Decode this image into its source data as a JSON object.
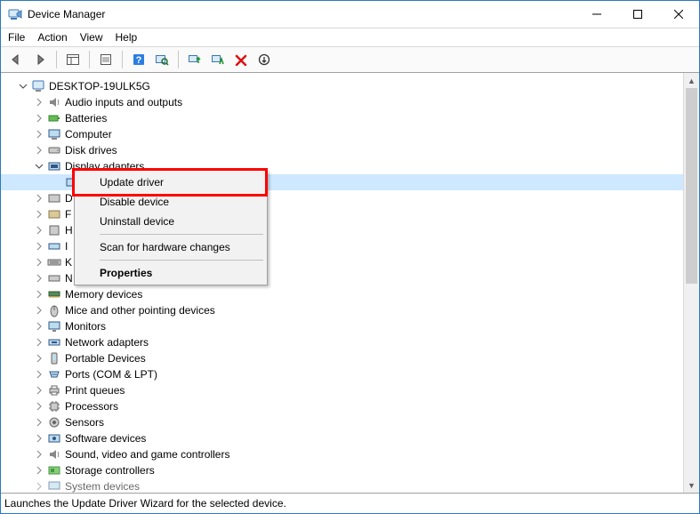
{
  "window": {
    "title": "Device Manager"
  },
  "menu": {
    "file": "File",
    "action": "Action",
    "view": "View",
    "help": "Help"
  },
  "tree": {
    "root": "DESKTOP-19ULK5G",
    "nodes": {
      "n0": "Audio inputs and outputs",
      "n1": "Batteries",
      "n2": "Computer",
      "n3": "Disk drives",
      "n4": "Display adapters",
      "n5": "D",
      "n6": "F",
      "n7": "H",
      "n8": "I",
      "n9": "K",
      "n10": "N",
      "n11": "Memory devices",
      "n12": "Mice and other pointing devices",
      "n13": "Monitors",
      "n14": "Network adapters",
      "n15": "Portable Devices",
      "n16": "Ports (COM & LPT)",
      "n17": "Print queues",
      "n18": "Processors",
      "n19": "Sensors",
      "n20": "Software devices",
      "n21": "Sound, video and game controllers",
      "n22": "Storage controllers",
      "n23": "System devices"
    }
  },
  "context_menu": {
    "update_driver": "Update driver",
    "disable_device": "Disable device",
    "uninstall_device": "Uninstall device",
    "scan_for_changes": "Scan for hardware changes",
    "properties": "Properties"
  },
  "statusbar": {
    "text": "Launches the Update Driver Wizard for the selected device."
  }
}
